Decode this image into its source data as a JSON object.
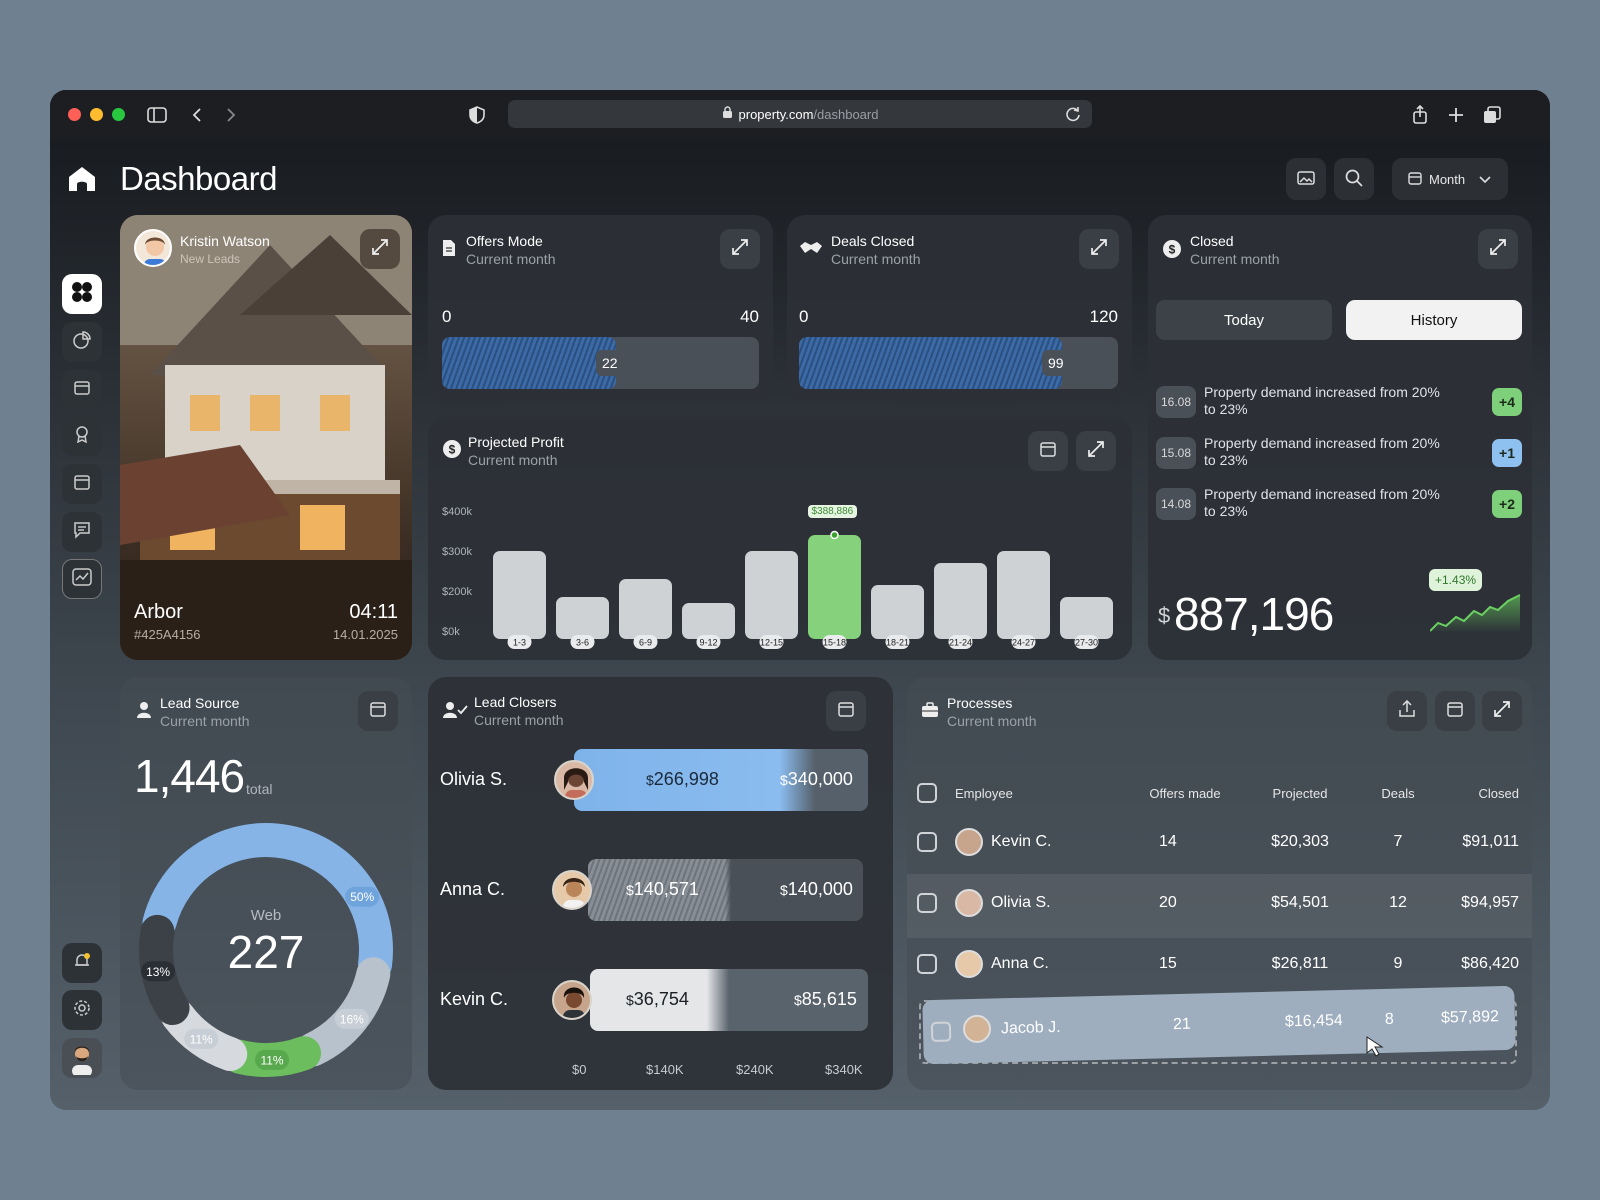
{
  "browser": {
    "url_host": "property.com",
    "url_path": "/dashboard"
  },
  "header": {
    "title": "Dashboard",
    "period_label": "Month"
  },
  "property": {
    "agent_name": "Kristin Watson",
    "agent_role": "New Leads",
    "name": "Arbor",
    "id": "#425A4156",
    "time": "04:11",
    "date": "14.01.2025"
  },
  "offers": {
    "title": "Offers Mode",
    "subtitle": "Current month",
    "min": "0",
    "max": "40",
    "value": "22",
    "fraction": 0.55
  },
  "deals": {
    "title": "Deals Closed",
    "subtitle": "Current month",
    "min": "0",
    "max": "120",
    "value": "99",
    "fraction": 0.825
  },
  "closed": {
    "title": "Closed",
    "subtitle": "Current month",
    "tabs": [
      "Today",
      "History"
    ],
    "active_tab": "History",
    "history": [
      {
        "date": "16.08",
        "text": "Property demand increased from 20% to 23%",
        "badge": "+4",
        "color": "#7ed07a"
      },
      {
        "date": "15.08",
        "text": "Property demand increased from 20% to 23%",
        "badge": "+1",
        "color": "#8ec1ef"
      },
      {
        "date": "14.08",
        "text": "Property demand increased from 20% to 23%",
        "badge": "+2",
        "color": "#7ed07a"
      }
    ],
    "currency": "$",
    "total": "887,196",
    "change": "+1.43%"
  },
  "profit": {
    "title": "Projected Profit",
    "subtitle": "Current month",
    "highlight_label": "$388,886"
  },
  "chart_data": {
    "type": "bar",
    "categories": [
      "1-3",
      "3-6",
      "6-9",
      "9-12",
      "12-15",
      "15-18",
      "18-21",
      "21-24",
      "24-27",
      "27-30"
    ],
    "values": [
      300000,
      170000,
      230000,
      140000,
      300000,
      340000,
      215000,
      270000,
      300000,
      170000
    ],
    "highlight_index": 5,
    "y_ticks": [
      "$0k",
      "$200k",
      "$300k",
      "$400k"
    ],
    "ylim": [
      0,
      400000
    ],
    "colors": {
      "bar": "#cfd2d5",
      "highlight": "#86d17b"
    }
  },
  "lead_source": {
    "title": "Lead Source",
    "subtitle": "Current month",
    "total": "1,446",
    "total_label": "total",
    "center_label": "Web",
    "center_value": "227",
    "segments": [
      {
        "label": "50%",
        "value": 50,
        "color": "#86b4e6"
      },
      {
        "label": "16%",
        "value": 16,
        "color": "#b8c2cc"
      },
      {
        "label": "11%",
        "value": 11,
        "color": "#6bbd5e"
      },
      {
        "label": "11%",
        "value": 11,
        "color": "#d6d9dd"
      },
      {
        "label": "13%",
        "value": 13,
        "color": "#3c4147"
      }
    ]
  },
  "lead_closers": {
    "title": "Lead Closers",
    "subtitle": "Current month",
    "rows": [
      {
        "name": "Olivia S.",
        "value": "266,998",
        "target": "340,000",
        "currency": "$"
      },
      {
        "name": "Anna C.",
        "value": "140,571",
        "target": "140,000",
        "currency": "$"
      },
      {
        "name": "Kevin C.",
        "value": "36,754",
        "target": "85,615",
        "currency": "$"
      }
    ],
    "axis": [
      "$0",
      "$140K",
      "$240K",
      "$340K"
    ]
  },
  "processes": {
    "title": "Processes",
    "subtitle": "Current month",
    "columns": [
      "Employee",
      "Offers made",
      "Projected",
      "Deals",
      "Closed"
    ],
    "rows": [
      {
        "name": "Kevin C.",
        "offers": "14",
        "projected": "$20,303",
        "deals": "7",
        "closed": "$91,011"
      },
      {
        "name": "Olivia S.",
        "offers": "20",
        "projected": "$54,501",
        "deals": "12",
        "closed": "$94,957"
      },
      {
        "name": "Anna C.",
        "offers": "15",
        "projected": "$26,811",
        "deals": "9",
        "closed": "$86,420"
      }
    ],
    "dragged": {
      "name": "Jacob J.",
      "offers": "21",
      "projected": "$16,454",
      "deals": "8",
      "closed": "$57,892"
    }
  }
}
